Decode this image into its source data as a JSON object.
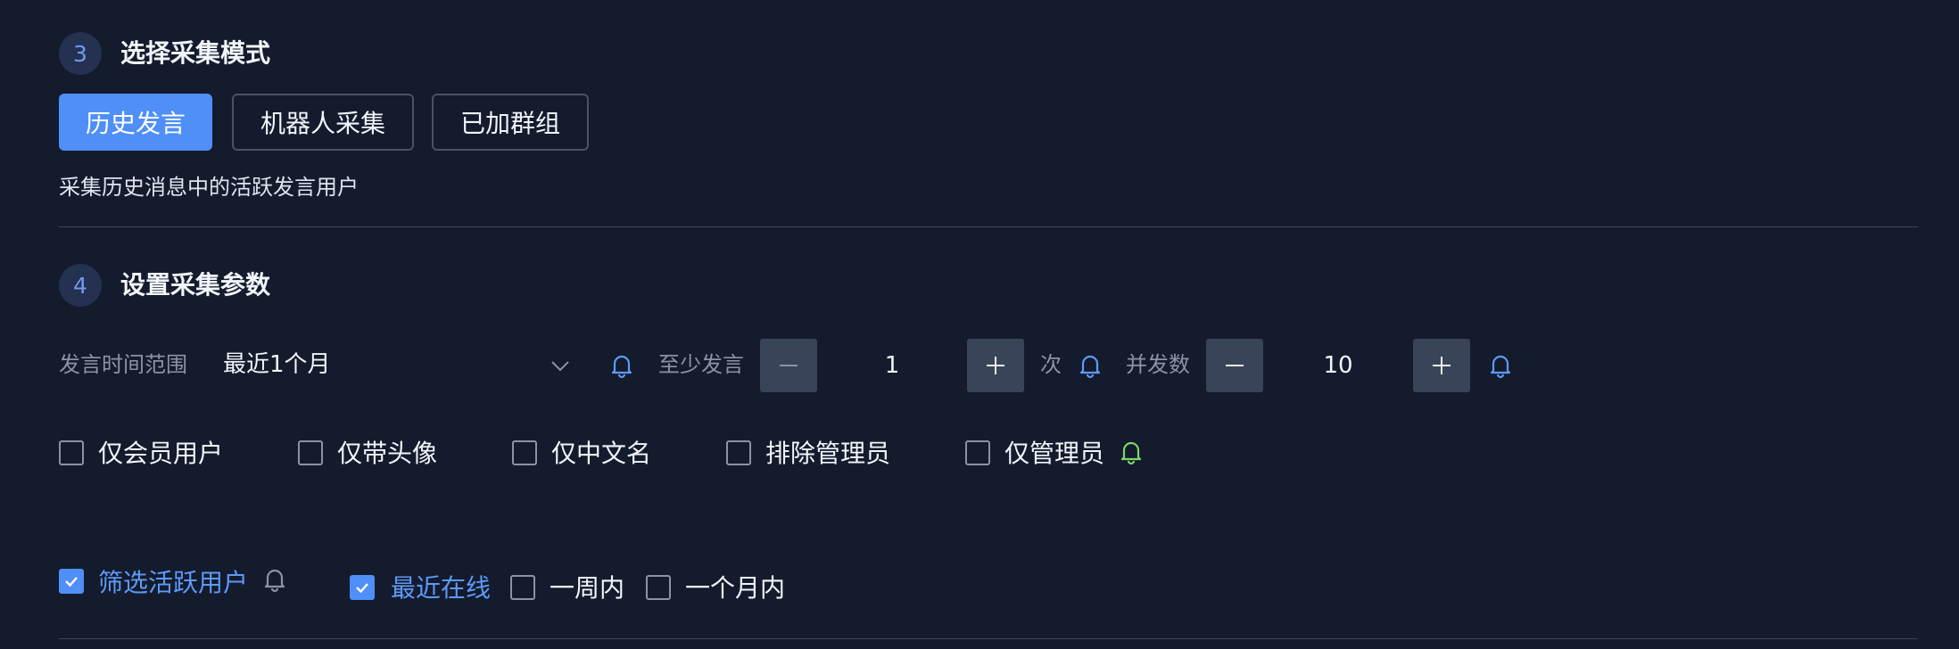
{
  "section3": {
    "step": "3",
    "title": "选择采集模式",
    "modes": [
      "历史发言",
      "机器人采集",
      "已加群组"
    ],
    "active_mode": "历史发言",
    "description": "采集历史消息中的活跃发言用户"
  },
  "section4": {
    "step": "4",
    "title": "设置采集参数",
    "time_range": {
      "label": "发言时间范围",
      "value": "最近1个月"
    },
    "min_speak": {
      "label": "至少发言",
      "value": "1",
      "unit": "次"
    },
    "concurrency": {
      "label": "并发数",
      "value": "10"
    },
    "filters": [
      {
        "label": "仅会员用户",
        "checked": false
      },
      {
        "label": "仅带头像",
        "checked": false
      },
      {
        "label": "仅中文名",
        "checked": false
      },
      {
        "label": "排除管理员",
        "checked": false
      },
      {
        "label": "仅管理员",
        "checked": false
      }
    ],
    "active_filter": {
      "label": "筛选活跃用户",
      "checked": true
    },
    "recency_options": [
      {
        "label": "最近在线",
        "checked": true
      },
      {
        "label": "一周内",
        "checked": false
      },
      {
        "label": "一个月内",
        "checked": false
      }
    ]
  },
  "icons": {
    "bell_default": "bell-icon",
    "chevron": "chevron-down-icon",
    "minus": "minus-icon",
    "plus": "plus-icon",
    "check": "check-icon"
  },
  "colors": {
    "background": "#141b2d",
    "accent": "#4f8ff7",
    "bell_blue": "#5d9af8",
    "bell_green": "#7ed36a",
    "bell_gray": "#8b93a6"
  }
}
